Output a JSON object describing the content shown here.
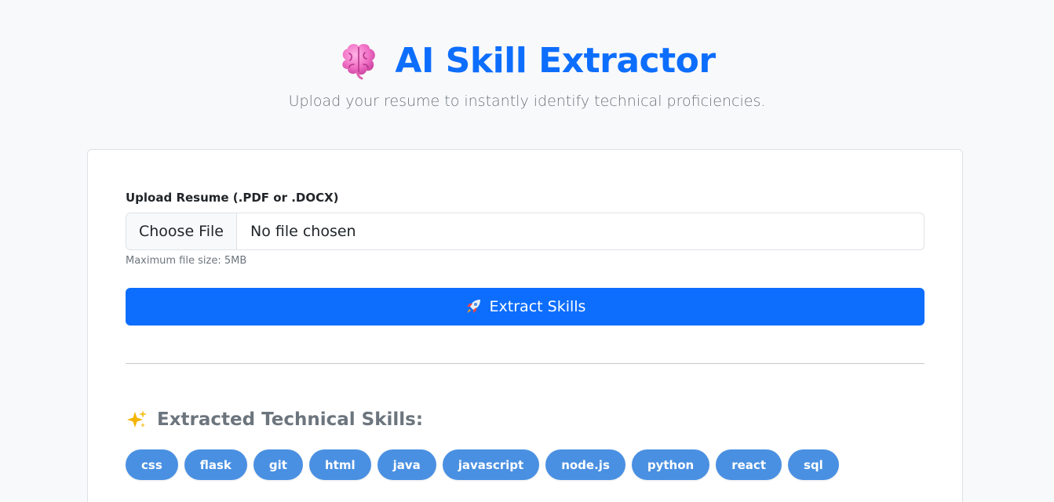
{
  "header": {
    "title": "AI Skill Extractor",
    "subtitle": "Upload your resume to instantly identify technical proficiencies.",
    "icon": "brain-icon"
  },
  "upload": {
    "label": "Upload Resume (.PDF or .DOCX)",
    "button_label": "Choose File",
    "status": "No file chosen",
    "help": "Maximum file size: 5MB"
  },
  "extract_button": {
    "label": "Extract Skills",
    "icon": "rocket-icon"
  },
  "results": {
    "heading": "Extracted Technical Skills:",
    "icon": "sparkle-icon",
    "skills": [
      "css",
      "flask",
      "git",
      "html",
      "java",
      "javascript",
      "node.js",
      "python",
      "react",
      "sql"
    ]
  },
  "colors": {
    "primary": "#0d6efd",
    "badge": "#4a90e2",
    "muted": "#6c757d",
    "background": "#f8f9fa"
  }
}
